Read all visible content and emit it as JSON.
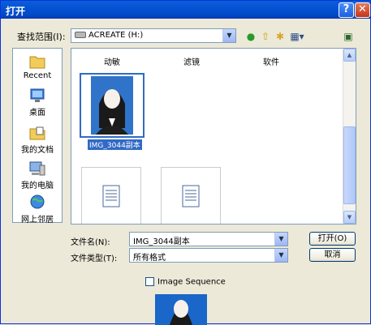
{
  "window": {
    "title": "打开",
    "help_label": "?",
    "close_label": "✕"
  },
  "look_in": {
    "label": "查找范围(I):",
    "value": "ACREATE (H:)"
  },
  "toolbar": {
    "icons": [
      "back-icon",
      "up-folder-icon",
      "new-folder-icon",
      "view-menu-icon",
      "browse-icon"
    ]
  },
  "places": [
    {
      "label": "Recent",
      "icon": "recent-icon"
    },
    {
      "label": "桌面",
      "icon": "desktop-icon"
    },
    {
      "label": "我的文档",
      "icon": "my-documents-icon"
    },
    {
      "label": "我的电脑",
      "icon": "my-computer-icon"
    },
    {
      "label": "网上邻居",
      "icon": "network-icon"
    }
  ],
  "files": {
    "folders": [
      "动敏",
      "滤镜",
      "软件"
    ],
    "selected_file": "IMG_3044副本",
    "doc_items": [
      "document-icon",
      "document-icon"
    ]
  },
  "filename": {
    "label": "文件名(N):",
    "value": "IMG_3044副本"
  },
  "filetype": {
    "label": "文件类型(T):",
    "value": "所有格式"
  },
  "buttons": {
    "open": "打开(O)",
    "cancel": "取消"
  },
  "image_sequence": {
    "label": "Image Sequence",
    "checked": false
  },
  "colors": {
    "titlebar": "#0553d4",
    "selection": "#316ac5",
    "dialog_bg": "#ece9d8"
  }
}
